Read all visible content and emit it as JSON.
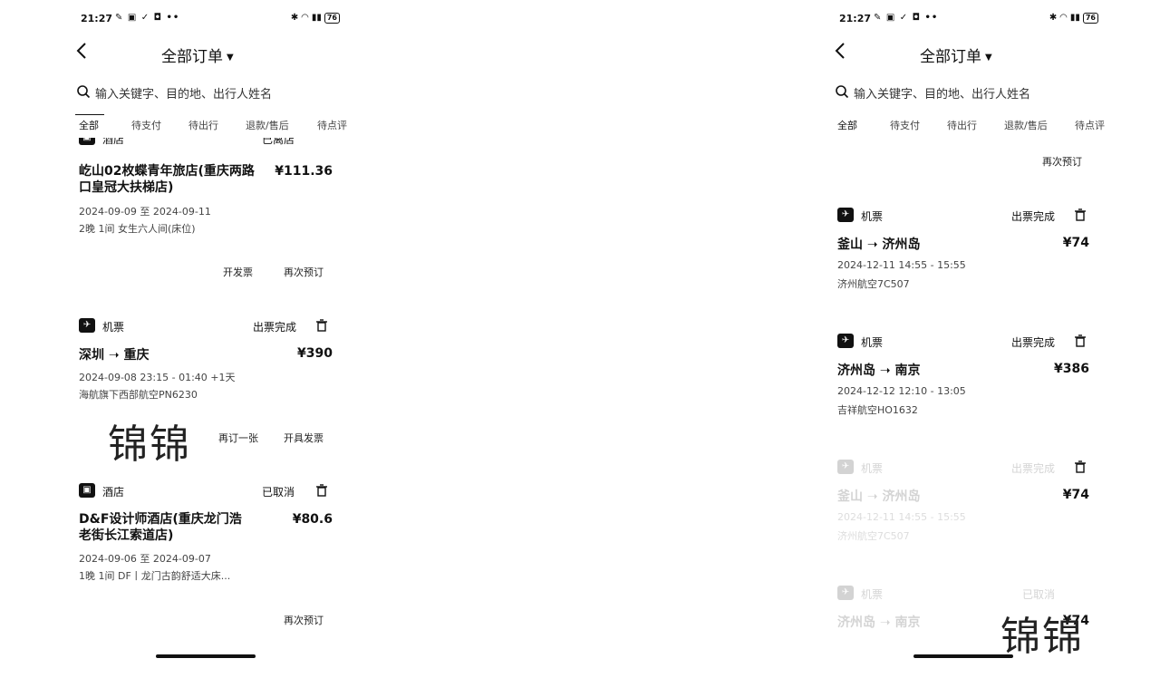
{
  "status_bar": {
    "time": "21:27",
    "left_icons": "✎ ▣ ✓ ◘ ••",
    "right_icons": "✱ ◠ ▮▮",
    "battery": "76"
  },
  "header": {
    "title": "全部订单"
  },
  "search": {
    "placeholder": "输入关键字、目的地、出行人姓名"
  },
  "tabs": [
    "全部",
    "待支付",
    "待出行",
    "退款/售后",
    "待点评"
  ],
  "left": {
    "cut_top": {
      "type": "酒店",
      "status": "已离店"
    },
    "hotel1": {
      "name": "屹山02枚蝶青年旅店(重庆两路口皇冠大扶梯店)",
      "price": "¥111.36",
      "dates": "2024-09-09 至 2024-09-11",
      "detail": "2晚  1间  女生六人间(床位)",
      "btn_invoice": "开发票",
      "btn_rebook": "再次预订"
    },
    "flight1": {
      "type": "机票",
      "status": "出票完成",
      "route": "深圳 ➝ 重庆",
      "price": "¥390",
      "time": "2024-09-08 23:15 - 01:40 +1天",
      "airline": "海航旗下西部航空PN6230",
      "btn_again": "再订一张",
      "btn_invoice": "开具发票"
    },
    "hotel2": {
      "type": "酒店",
      "status": "已取消",
      "name": "D&F设计师酒店(重庆龙门浩老街长江索道店)",
      "price": "¥80.6",
      "dates": "2024-09-06 至 2024-09-07",
      "detail": "1晚  1间  DF丨龙门古韵舒适大床...",
      "btn_rebook": "再次预订"
    },
    "watermark": "锦锦"
  },
  "right": {
    "btn_rebook_top": "再次预订",
    "flight1": {
      "type": "机票",
      "status": "出票完成",
      "route": "釜山 ➝ 济州岛",
      "price": "¥74",
      "time": "2024-12-11 14:55 - 15:55",
      "airline": "济州航空7C507"
    },
    "flight2": {
      "type": "机票",
      "status": "出票完成",
      "route": "济州岛 ➝ 南京",
      "price": "¥386",
      "time": "2024-12-12 12:10 - 13:05",
      "airline": "吉祥航空HO1632"
    },
    "flight3": {
      "type": "机票",
      "status": "出票完成",
      "route": "釜山 ➝ 济州岛",
      "price": "¥74",
      "time": "2024-12-11 14:55 - 15:55",
      "airline": "济州航空7C507"
    },
    "flight4": {
      "type": "机票",
      "status": "已取消",
      "route": "济州岛 ➝ 南京",
      "price": "¥74"
    },
    "watermark": "锦锦"
  }
}
